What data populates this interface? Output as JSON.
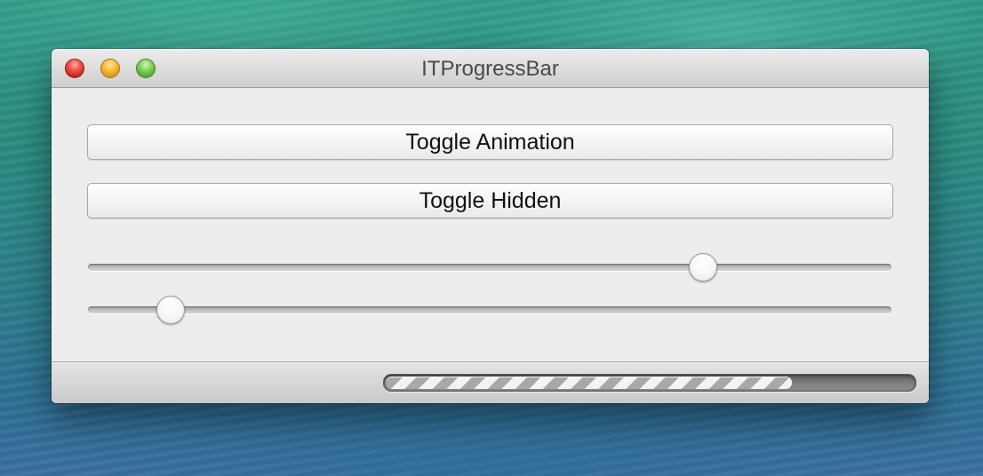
{
  "window": {
    "title": "ITProgressBar"
  },
  "buttons": {
    "toggle_animation_label": "Toggle Animation",
    "toggle_hidden_label": "Toggle Hidden"
  },
  "sliders": [
    {
      "value": 0.765
    },
    {
      "value": 0.103
    }
  ],
  "progress_bar": {
    "value": 0.77,
    "animated": true,
    "hidden": false
  },
  "colors": {
    "close": "#e0443a",
    "minimize": "#f1b132",
    "zoom": "#6cc24a"
  },
  "icons": {
    "close": "close-icon",
    "minimize": "minimize-icon",
    "zoom": "zoom-icon"
  }
}
